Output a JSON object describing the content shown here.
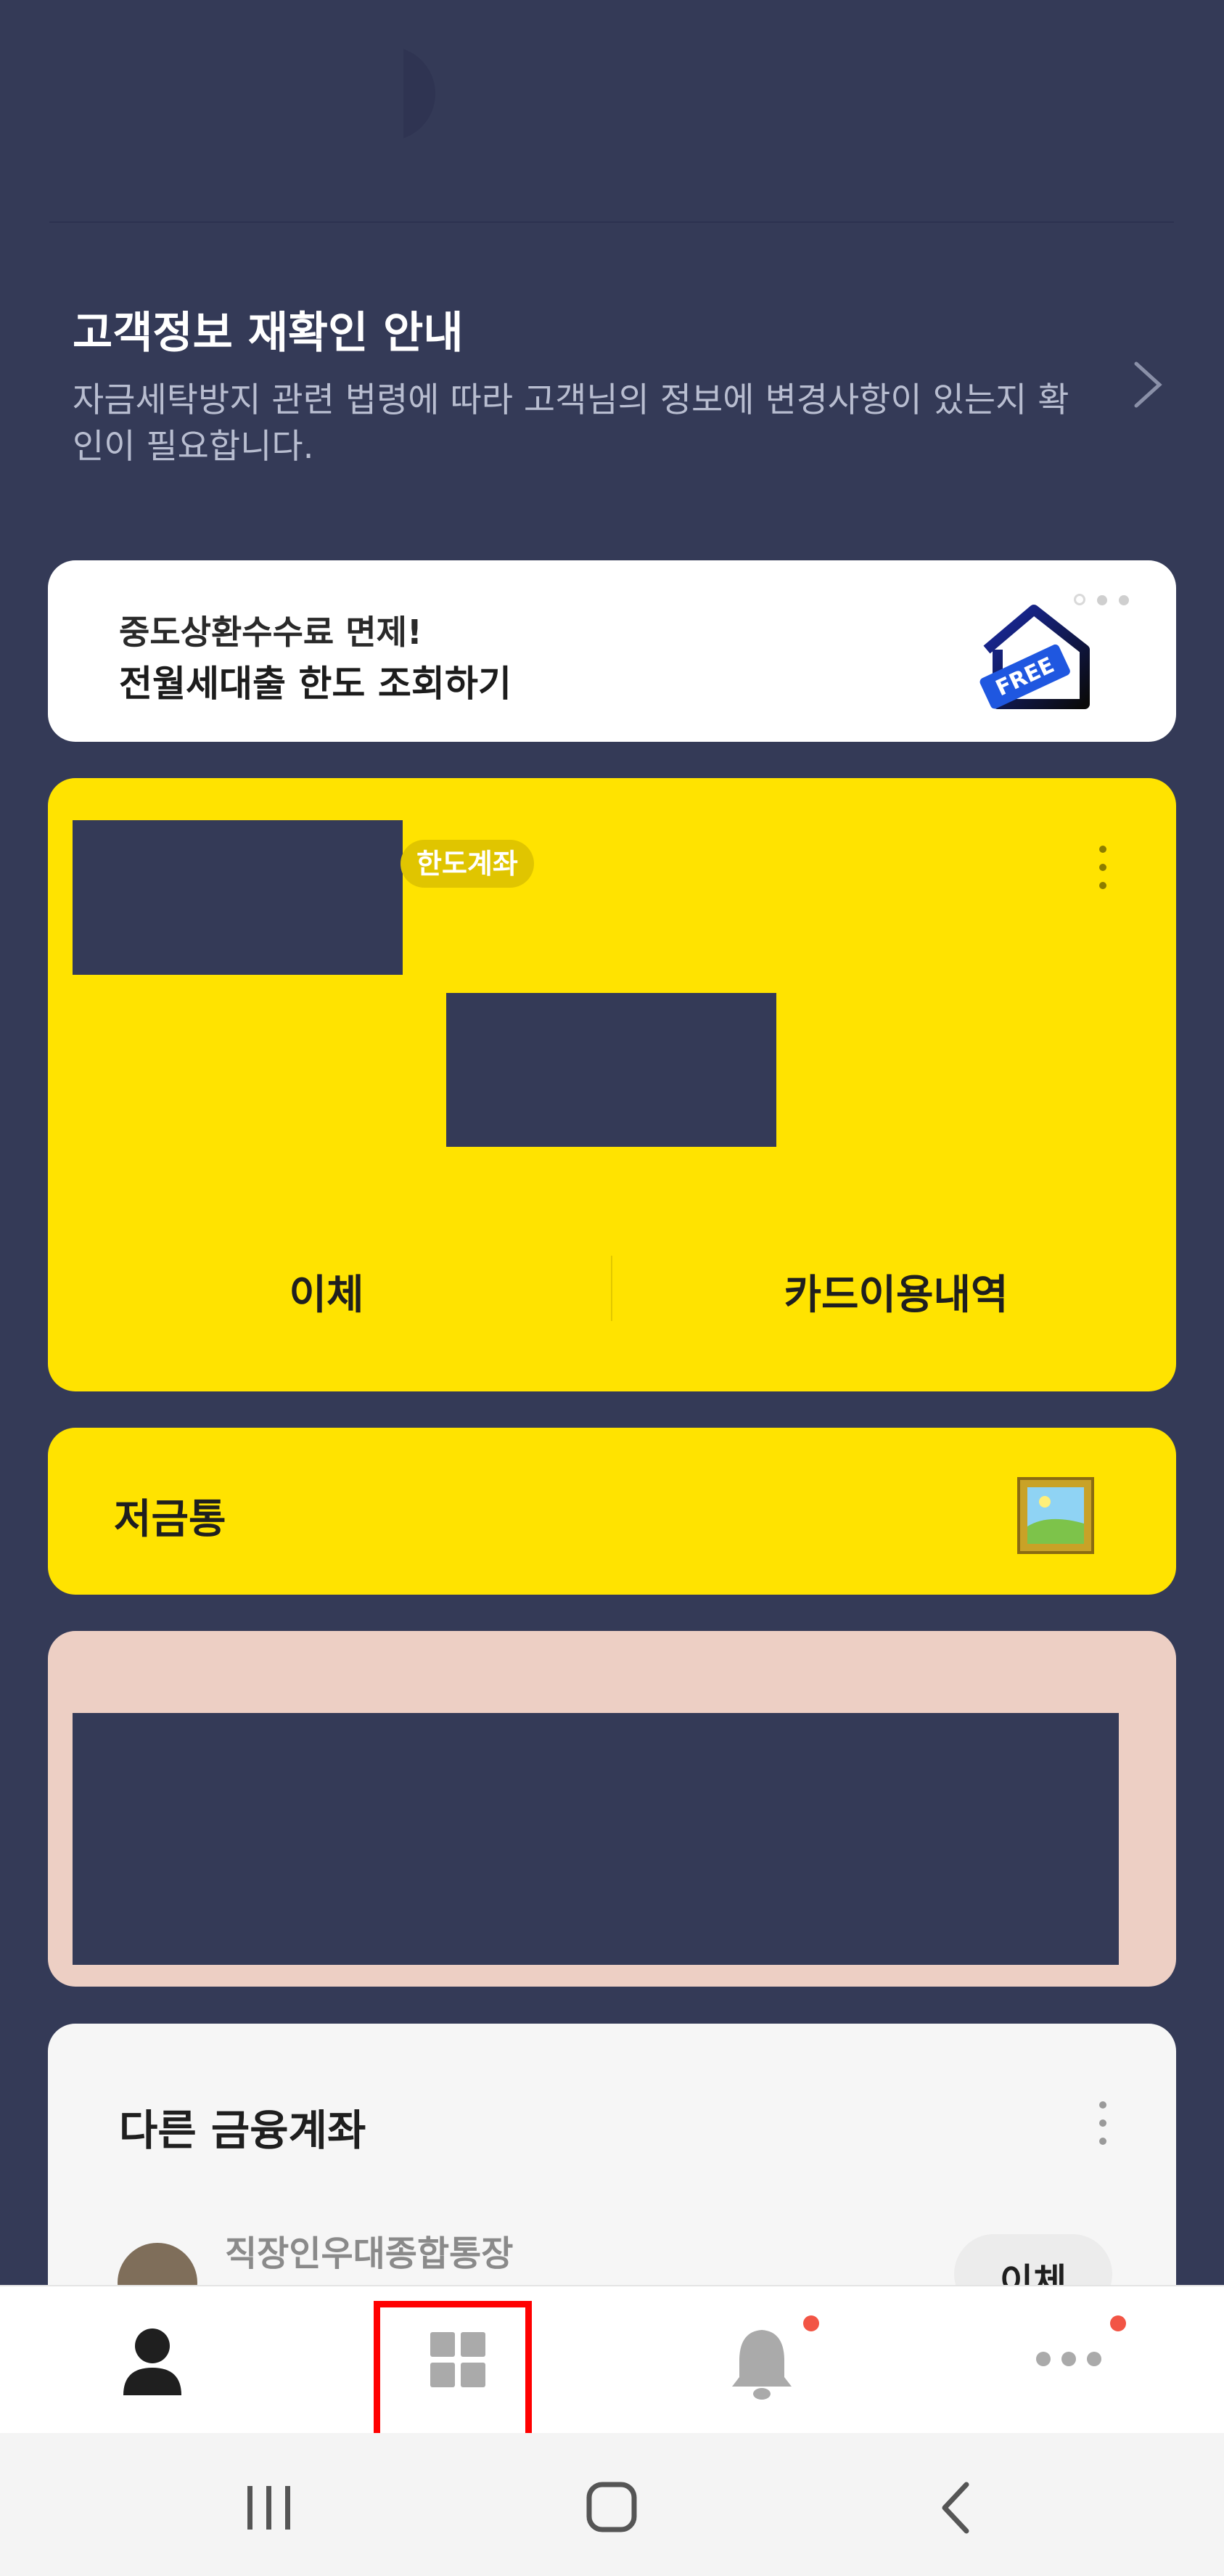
{
  "notice": {
    "title": "고객정보 재확인 안내",
    "description": "자금세탁방지 관련 법령에 따라 고객님의 정보에 변경사항이 있는지 확인이 필요합니다."
  },
  "banner": {
    "line1": "중도상환수수료 면제!",
    "line2": "전월세대출 한도 조회하기",
    "icon_badge": "FREE",
    "page_dots": 3
  },
  "account_card": {
    "badge": "한도계좌",
    "transfer_label": "이체",
    "history_label": "카드이용내역",
    "color": "#ffe300"
  },
  "piggy_bank": {
    "label": "저금통"
  },
  "other_accounts": {
    "title": "다른 금융계좌",
    "items": [
      {
        "name": "직장인우대종합통장",
        "transfer_label": "이체"
      }
    ]
  },
  "tabbar": {
    "tabs": [
      {
        "name": "person-icon"
      },
      {
        "name": "grid-icon"
      },
      {
        "name": "bell-icon"
      },
      {
        "name": "more-icon"
      }
    ]
  },
  "colors": {
    "background": "#343a57",
    "accent_yellow": "#ffe300",
    "pink_card": "#edcfc4",
    "highlight": "#ff0000",
    "notification_dot": "#f25545"
  }
}
